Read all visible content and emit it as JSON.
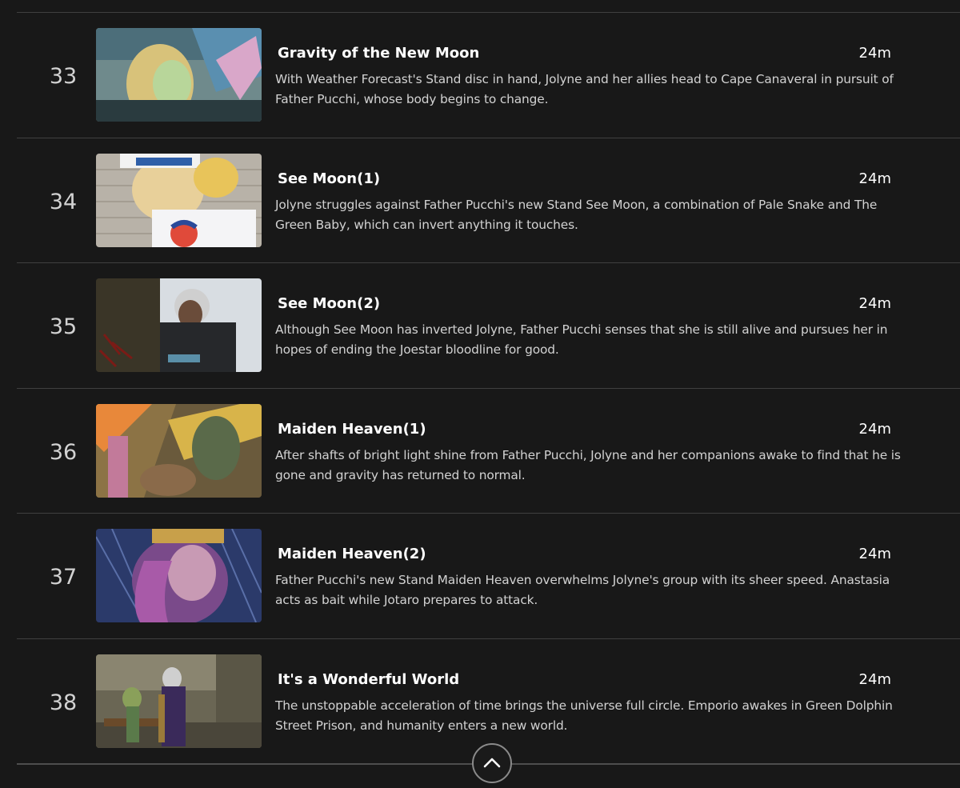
{
  "episodes": [
    {
      "number": "33",
      "title": "Gravity of the New Moon",
      "duration": "24m",
      "synopsis": "With Weather Forecast's Stand disc in hand, Jolyne and her allies head to Cape Canaveral in pursuit of Father Pucchi, whose body begins to change."
    },
    {
      "number": "34",
      "title": "See Moon(1)",
      "duration": "24m",
      "synopsis": "Jolyne struggles against Father Pucchi's new Stand See Moon, a combination of Pale Snake and The Green Baby, which can invert anything it touches."
    },
    {
      "number": "35",
      "title": "See Moon(2)",
      "duration": "24m",
      "synopsis": "Although See Moon has inverted Jolyne, Father Pucchi senses that she is still alive and pursues her in hopes of ending the Joestar bloodline for good."
    },
    {
      "number": "36",
      "title": "Maiden Heaven(1)",
      "duration": "24m",
      "synopsis": "After shafts of bright light shine from Father Pucchi, Jolyne and her companions awake to find that he is gone and gravity has returned to normal."
    },
    {
      "number": "37",
      "title": "Maiden Heaven(2)",
      "duration": "24m",
      "synopsis": "Father Pucchi's new Stand Maiden Heaven overwhelms Jolyne's group with its sheer speed. Anastasia acts as bait while Jotaro prepares to attack."
    },
    {
      "number": "38",
      "title": "It's a Wonderful World",
      "duration": "24m",
      "synopsis": "The unstoppable acceleration of time brings the universe full circle. Emporio awakes in Green Dolphin Street Prison, and humanity enters a new world."
    }
  ],
  "collapse_icon": "chevron-up-icon",
  "colors": {
    "background": "#181818",
    "divider": "#404040",
    "text_primary": "#ffffff",
    "text_secondary": "#d2d2d2"
  }
}
